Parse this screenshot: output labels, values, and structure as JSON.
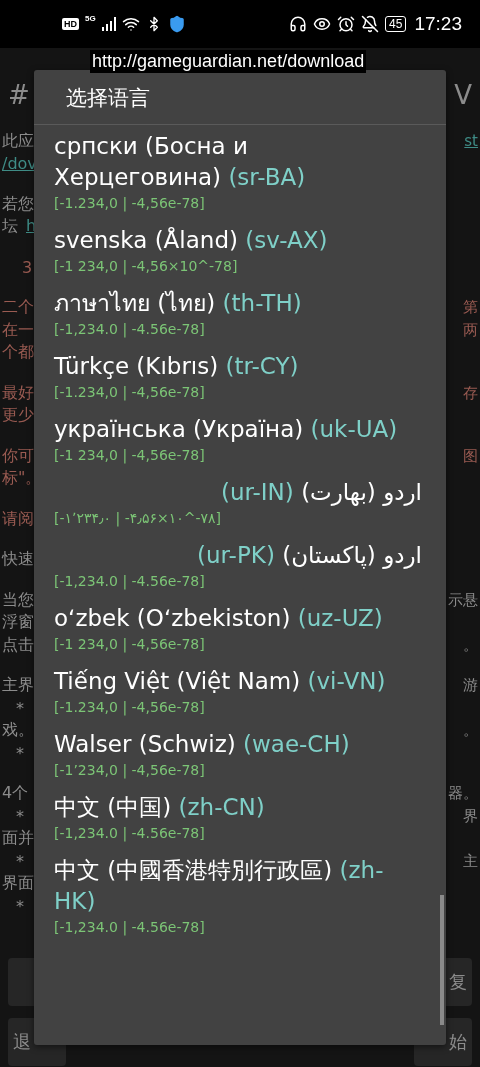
{
  "status_bar": {
    "hd": "HD",
    "network": "5G",
    "battery": "45",
    "time": "17:23"
  },
  "toast": {
    "text": "http://gameguardian.net/download"
  },
  "background": {
    "paragraphs": [
      {
        "lines": [
          {
            "left": {
              "text": "#",
              "kind": "heading"
            },
            "right": {
              "text": "V",
              "kind": "heading"
            }
          }
        ]
      },
      {
        "lines": [
          {
            "left": {
              "text": "此应",
              "kind": "plain"
            },
            "right": {
              "text": "st",
              "kind": "link"
            }
          },
          {
            "left": {
              "text": "/dov",
              "kind": "link"
            }
          }
        ]
      },
      {
        "lines": [
          {
            "left": {
              "text": "若您",
              "kind": "plain"
            }
          },
          {
            "left": {
              "text": "坛",
              "kind": "plain"
            },
            "left_link": {
              "text": "h",
              "kind": "link"
            }
          }
        ]
      },
      {
        "lines": [
          {
            "left": {
              "text": "3",
              "kind": "note_indent"
            }
          }
        ]
      },
      {
        "lines": [
          {
            "left": {
              "text": "二个",
              "kind": "note"
            },
            "right": {
              "text": "第",
              "kind": "note"
            }
          },
          {
            "left": {
              "text": "在一",
              "kind": "note"
            },
            "right": {
              "text": "两",
              "kind": "note"
            }
          },
          {
            "left": {
              "text": "个都",
              "kind": "note"
            }
          }
        ]
      },
      {
        "lines": [
          {
            "left": {
              "text": "最好",
              "kind": "note"
            },
            "right": {
              "text": "存",
              "kind": "note"
            }
          },
          {
            "left": {
              "text": "更少",
              "kind": "note"
            }
          }
        ]
      },
      {
        "lines": [
          {
            "left": {
              "text": "你可",
              "kind": "note"
            },
            "right": {
              "text": "图",
              "kind": "note"
            }
          },
          {
            "left": {
              "text": "标\"。",
              "kind": "note"
            }
          }
        ]
      },
      {
        "lines": [
          {
            "left": {
              "text": "请阅",
              "kind": "note"
            }
          }
        ]
      },
      {
        "lines": [
          {
            "left": {
              "text": "快速",
              "kind": "plain"
            }
          }
        ]
      },
      {
        "lines": [
          {
            "left": {
              "text": "当您",
              "kind": "plain"
            },
            "right": {
              "text": "示悬",
              "kind": "plain"
            }
          },
          {
            "left": {
              "text": "浮窗",
              "kind": "plain"
            }
          },
          {
            "left": {
              "text": "点击",
              "kind": "plain"
            },
            "right": {
              "text": "。",
              "kind": "plain"
            }
          }
        ]
      },
      {
        "lines": [
          {
            "left": {
              "text": "主界",
              "kind": "plain"
            },
            "right": {
              "text": "游",
              "kind": "plain"
            }
          },
          {
            "left": {
              "text": "*",
              "kind": "bullet"
            }
          },
          {
            "left": {
              "text": "戏。",
              "kind": "plain"
            },
            "right": {
              "text": "。",
              "kind": "plain"
            }
          },
          {
            "left": {
              "text": "*",
              "kind": "bullet"
            }
          }
        ]
      },
      {
        "lines": [
          {
            "left": {
              "text": "4个",
              "kind": "plain"
            },
            "right": {
              "text": "器。",
              "kind": "plain"
            }
          },
          {
            "left": {
              "text": "*",
              "kind": "bullet"
            },
            "right": {
              "text": "界",
              "kind": "plain"
            }
          },
          {
            "left": {
              "text": "面并",
              "kind": "plain"
            }
          },
          {
            "left": {
              "text": "*",
              "kind": "bullet"
            },
            "right": {
              "text": "主",
              "kind": "plain"
            }
          },
          {
            "left": {
              "text": "界面",
              "kind": "plain"
            }
          },
          {
            "left": {
              "text": "*",
              "kind": "bullet"
            }
          }
        ]
      }
    ],
    "buttons": [
      {
        "right": "复"
      },
      {
        "left": "退",
        "right": "始"
      }
    ]
  },
  "dialog": {
    "title": "选择语言",
    "items": [
      {
        "name": "српски (Босна и Херцеговина)",
        "code": "(sr-BA)",
        "sample": "[-1.234,0 | -4,56e-78]",
        "kind": "ltr"
      },
      {
        "name": "svenska (Åland)",
        "code": "(sv-AX)",
        "sample": "[-1 234,0 | -4,56×10^-78]",
        "kind": "ltr"
      },
      {
        "name": "ภาษาไทย (ไทย)",
        "code": "(th-TH)",
        "sample": "[-1,234.0 | -4.56e-78]",
        "kind": "ltr"
      },
      {
        "name": "Türkçe (Kıbrıs)",
        "code": "(tr-CY)",
        "sample": "[-1.234,0 | -4,56e-78]",
        "kind": "ltr"
      },
      {
        "name": "українська (Україна)",
        "code": "(uk-UA)",
        "sample": "[-1 234,0 | -4,56e-78]",
        "kind": "ltr"
      },
      {
        "name": "اردو (بھارت)",
        "code": "(ur-IN)",
        "sample": "[-۱٬۲۳۴٫۰ | -۴٫۵۶×۱۰^-۷۸]",
        "kind": "rtl"
      },
      {
        "name": "اردو (پاکستان)",
        "code": "(ur-PK)",
        "sample": "[-1,234.0 | -4.56e-78]",
        "kind": "rtl"
      },
      {
        "name": "oʻzbek (Oʻzbekiston)",
        "code": "(uz-UZ)",
        "sample": "[-1 234,0 | -4,56e-78]",
        "kind": "ltr"
      },
      {
        "name": "Tiếng Việt (Việt Nam)",
        "code": "(vi-VN)",
        "sample": "[-1.234,0 | -4,56e-78]",
        "kind": "ltr"
      },
      {
        "name": "Walser (Schwiz)",
        "code": "(wae-CH)",
        "sample": "[-1’234,0 | -4,56e-78]",
        "kind": "ltr"
      },
      {
        "name": "中文 (中国)",
        "code": "(zh-CN)",
        "sample": "[-1,234.0 | -4.56e-78]",
        "kind": "ltr"
      },
      {
        "name": "中文 (中國香港特別行政區)",
        "code": "(zh-HK)",
        "sample": "[-1,234.0 | -4.56e-78]",
        "kind": "ltr"
      }
    ]
  }
}
